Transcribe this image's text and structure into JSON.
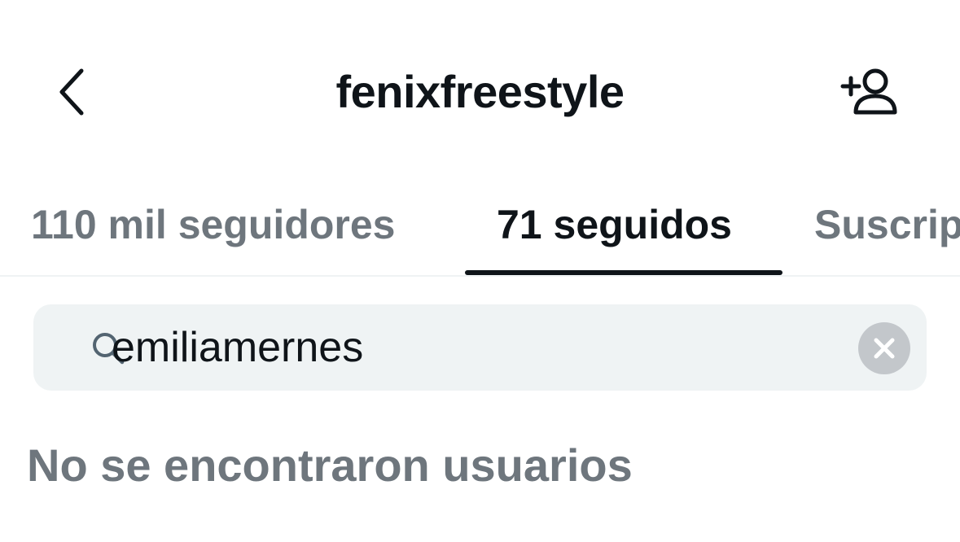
{
  "header": {
    "title": "fenixfreestyle",
    "back_icon": "chevron-left-icon",
    "add_user_icon": "person-plus-icon"
  },
  "tabs": [
    {
      "label": "110 mil seguidores",
      "active": false
    },
    {
      "label": "71 seguidos",
      "active": true
    },
    {
      "label": "Suscripciones",
      "active": false
    }
  ],
  "search": {
    "value": "emiliamernes",
    "icon": "search-icon",
    "clear_icon": "clear-icon"
  },
  "results": {
    "empty_message": "No se encontraron usuarios"
  },
  "colors": {
    "text_primary": "#0f1419",
    "text_secondary": "#6e767d",
    "search_background": "#eff3f4",
    "divider": "#eff3f4",
    "clear_button": "#c3c7cb"
  }
}
